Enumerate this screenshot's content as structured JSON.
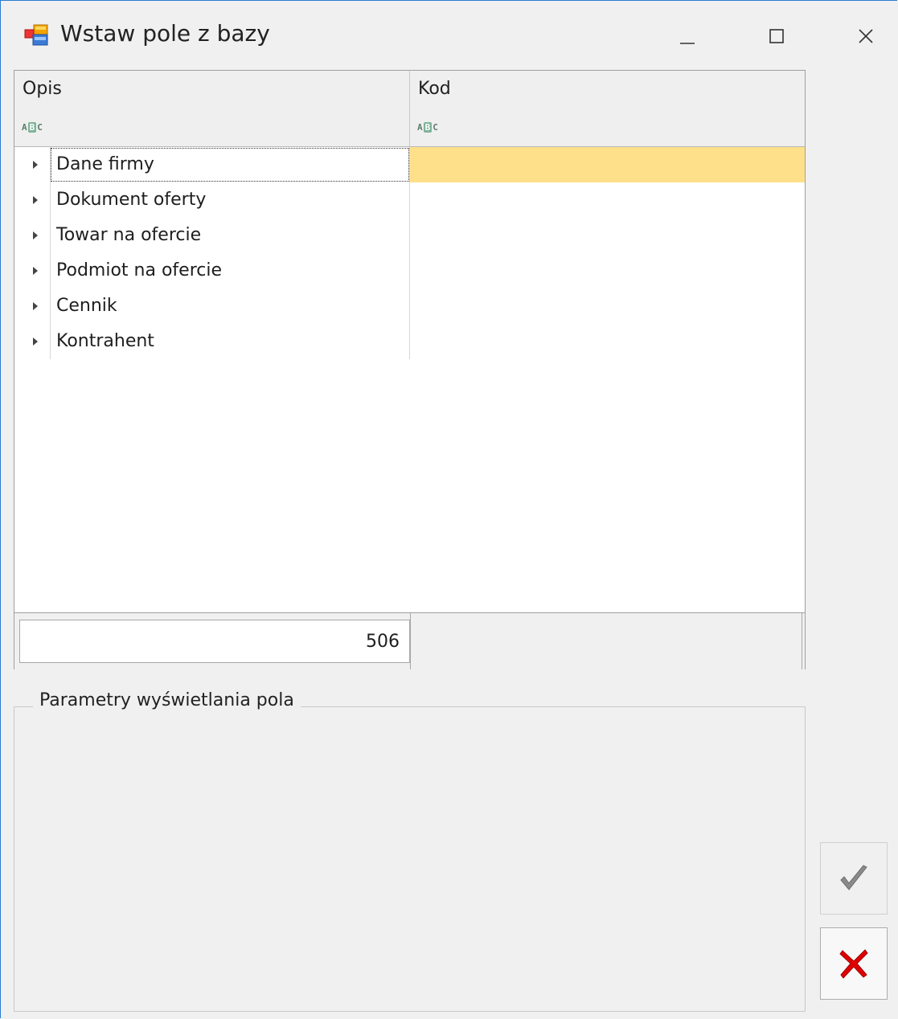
{
  "window": {
    "title": "Wstaw pole z bazy",
    "app_icon": "database-fields-icon",
    "controls": [
      "minimize-icon",
      "maximize-icon",
      "close-icon"
    ]
  },
  "grid": {
    "columns": [
      "Opis",
      "Kod"
    ],
    "filter_icon": "abc-filter-icon",
    "rows": [
      {
        "label": "Dane firmy",
        "kod": "",
        "focused": true
      },
      {
        "label": "Dokument oferty",
        "kod": ""
      },
      {
        "label": "Towar na ofercie",
        "kod": ""
      },
      {
        "label": "Podmiot na ofercie",
        "kod": ""
      },
      {
        "label": "Cennik",
        "kod": ""
      },
      {
        "label": "Kontrahent",
        "kod": ""
      }
    ],
    "footer_count": "506"
  },
  "params_group": {
    "title": "Parametry wyświetlania pola"
  },
  "buttons": {
    "ok_icon": "checkmark-icon",
    "cancel_icon": "red-x-icon"
  },
  "colors": {
    "focus_row": "#ffe08a",
    "window_border": "#2b7cd3",
    "cancel_red": "#e00000"
  }
}
